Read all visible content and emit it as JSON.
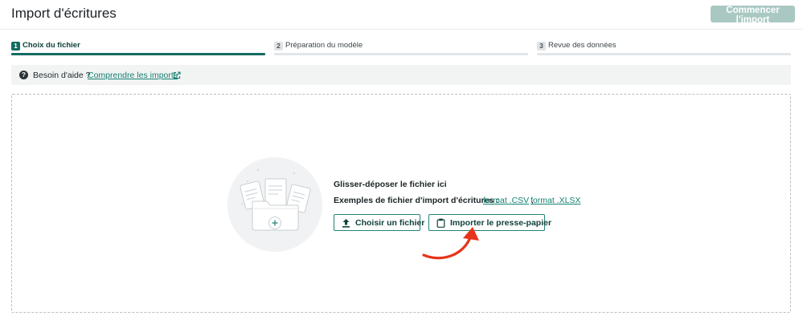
{
  "header": {
    "title": "Import d'écritures",
    "start_button": "Commencer l'import"
  },
  "steps": [
    {
      "number": "1",
      "label": "Choix du fichier",
      "state": "active"
    },
    {
      "number": "2",
      "label": "Préparation du modèle",
      "state": "inactive"
    },
    {
      "number": "3",
      "label": "Revue des données",
      "state": "inactive"
    }
  ],
  "help": {
    "icon": "question-circle-icon",
    "text": "Besoin d'aide ?",
    "link": "Comprendre les imports",
    "link_icon": "external-link-icon"
  },
  "dropzone": {
    "illustration": "folder-with-documents-illustration",
    "title": "Glisser-déposer le fichier ici",
    "examples_label": "Exemples de fichier d'import d'écritures :",
    "format_csv": "format .CSV",
    "separator": ",",
    "format_xlsx": "format .XLSX",
    "choose_button": "Choisir un fichier",
    "choose_icon": "upload-icon",
    "clipboard_button": "Importer le presse-papier",
    "clipboard_icon": "clipboard-icon"
  },
  "colors": {
    "accent": "#136b5f",
    "link": "#168173",
    "disabled_button": "#a9c8c2",
    "annotation_arrow": "#e8341c"
  }
}
